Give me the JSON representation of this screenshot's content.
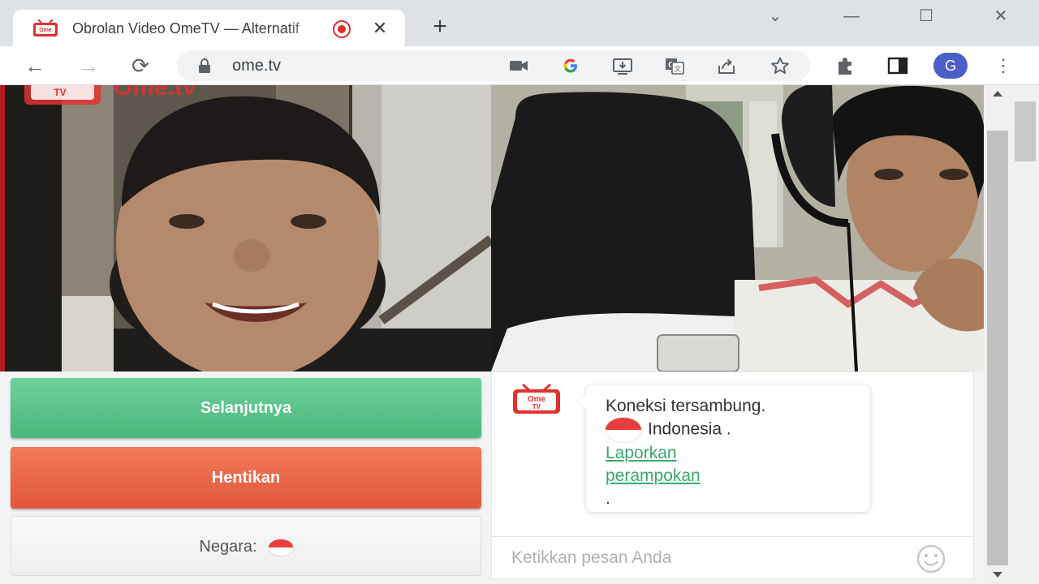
{
  "browser": {
    "tab_title": "Obrolan Video OmeTV — Alternatif",
    "tab_close_glyph": "✕",
    "new_tab_glyph": "+",
    "url": "ome.tv",
    "profile_initial": "G",
    "window_controls": {
      "minimize": "—",
      "maximize": "☐",
      "close": "✕",
      "tab_search": "⌄"
    },
    "nav": {
      "back": "←",
      "forward": "→",
      "reload": "⟳"
    }
  },
  "page": {
    "watermark": "Ome.tv",
    "buttons": {
      "next": "Selanjutnya",
      "stop": "Hentikan",
      "country_label": "Negara:"
    },
    "chat": {
      "logo_text_top": "Ome",
      "logo_text_bottom": "TV",
      "message_connected": "Koneksi tersambung.",
      "country_name": "Indonesia .",
      "report_link": "Laporkan perampokan",
      "trailing_dot": ".",
      "input_placeholder": "Ketikkan pesan Anda"
    }
  },
  "colors": {
    "next_button": "#49b879",
    "stop_button": "#e2563a",
    "link": "#3aa86b",
    "brand_red": "#e0322f"
  },
  "icons": [
    "ometv-favicon",
    "recording-icon",
    "camera-icon",
    "google-translate-icon",
    "install-icon",
    "translate-icon",
    "share-icon",
    "star-icon",
    "extensions-icon",
    "sidepanel-icon",
    "emoji-icon"
  ]
}
